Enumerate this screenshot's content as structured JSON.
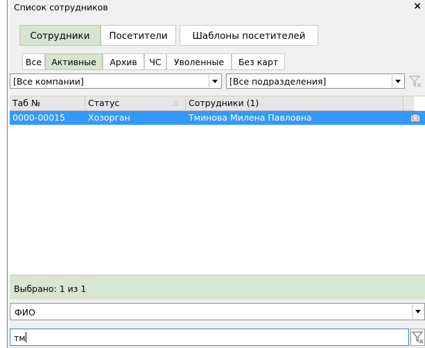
{
  "window": {
    "title": "Список сотрудников",
    "close_label": "×"
  },
  "main_tabs": [
    {
      "label": "Сотрудники",
      "active": true
    },
    {
      "label": "Посетители",
      "active": false
    },
    {
      "label": "Шаблоны посетителей",
      "active": false
    }
  ],
  "sub_tabs": [
    {
      "label": "Все",
      "active": false
    },
    {
      "label": "Активные",
      "active": true
    },
    {
      "label": "Архив",
      "active": false
    },
    {
      "label": "ЧС",
      "active": false
    },
    {
      "label": "Уволенные",
      "active": false
    },
    {
      "label": "Без карт",
      "active": false
    }
  ],
  "filters": {
    "company": "[Все компании]",
    "department": "[Все подразделения]"
  },
  "grid": {
    "columns": [
      "Таб №",
      "Статус",
      "Сотрудники (1)"
    ],
    "sort_indicator": "△",
    "rows": [
      {
        "tab_no": "0000-00015",
        "status": "Хозорган",
        "name": "Тминова Милена Павловна"
      }
    ]
  },
  "status": {
    "selected_text": "Выбрано: 1 из 1"
  },
  "search": {
    "field": "ФИО",
    "query": "тм"
  },
  "colors": {
    "selection": "#3399ff",
    "active_tab": "#d7e4d0",
    "status_bar": "#d9e4d2"
  }
}
